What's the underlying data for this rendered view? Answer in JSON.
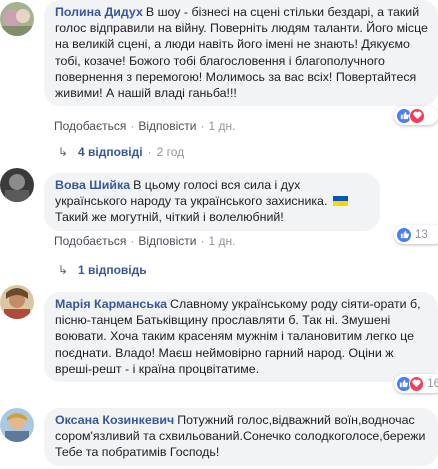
{
  "comments": [
    {
      "author": "Полина Дидух",
      "text": "В шоу - бізнесі на сцені стільки бездарі, а такий голос відправили на війну. Поверніть людям таланти. Його місце на великій сцені, а люди навіть його імені не знають! Дякуємо тобі, козаче! Божого тобі благословення і благополучного повернення з перемогою! Молимось за вас всіх! Повертайтеся живими! А нашій владі ганьба!!!",
      "like": "Подобається",
      "reply": "Відповісти",
      "time": "1 дн.",
      "reaction_count": "",
      "replies_label": "4 відповіді",
      "replies_time": "2 год"
    },
    {
      "author": "Вова Шийка",
      "text_before_flag": "В цьому голосі вся сила і дух українського народу та українського захисника.",
      "text_after_flag": "Такий же могутній, чіткий і волелюбний!",
      "like": "Подобається",
      "reply": "Відповісти",
      "time": "1 дн.",
      "reaction_count": "13",
      "replies_label": "1 відповідь"
    },
    {
      "author": "Марія Карманська",
      "text": "Славному українському роду сіяти-орати б, пісню-танцем Батьківщину прославляти б. Так ні. Змушені воювати. Хоча таким красеням мужнім і талановитим легко це поєднати. Владо! Маєш неймовірно гарний народ. Оціни ж вреші-решт - і країна процвітатиме.",
      "reaction_count": "16"
    },
    {
      "author": "Оксана Козинкевич",
      "text": "Потужний голос,відважний воїн,водночас сором'язливий та схвильований.Сонечко солодкоголосе,бережи Тебе та побратимів Господь!"
    }
  ],
  "colors": {
    "author": "#385898",
    "bubble": "#f2f3f5",
    "meta": "#606770",
    "like_reaction": "#4a7ff6",
    "love_reaction": "#f33e58"
  },
  "icons": [
    "like-reaction-icon",
    "love-reaction-icon",
    "reply-arrow-icon",
    "ukraine-flag-emoji"
  ]
}
